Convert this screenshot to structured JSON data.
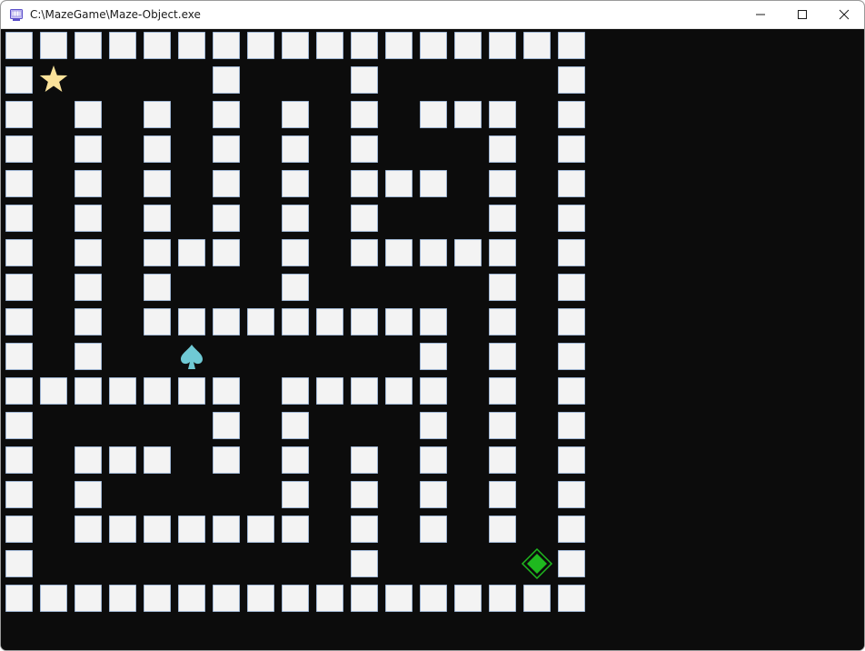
{
  "window": {
    "title": "C:\\MazeGame\\Maze-Object.exe",
    "app_icon": "application-icon",
    "controls": [
      "minimize-icon",
      "maximize-icon",
      "close-icon"
    ]
  },
  "maze": {
    "rows": 17,
    "cols": 17,
    "grid": [
      "#################",
      "#.....#...#.....#",
      "#.#.#.#.#.#.###.#",
      "#.#.#.#.#.#...#.#",
      "#.#.#.#.#.###.#.#",
      "#.#.#.#.#.#...#.#",
      "#.#.###.#.#####.#",
      "#.#.#...#.....#.#",
      "#.#.#########.#.#",
      "#.#.........#.#.#",
      "#######.#####.#.#",
      "#.....#.#...#.#.#",
      "#.###.#.#.#.#.#.#",
      "#.#.....#.#.#.#.#",
      "#.#######.#.#.#.#",
      "#.........#.....#",
      "#################"
    ],
    "colors": {
      "background": "#0c0c0c",
      "wall_fill": "#f3f3f3",
      "wall_edge": "#a8c4e8",
      "star": "#fbe29a",
      "spade": "#6fc9d4",
      "diamond": "#1fb81f",
      "diamond_outline": "#1fb81f"
    },
    "objects": [
      {
        "name": "star-icon",
        "glyph": "star",
        "row": 1,
        "col": 1
      },
      {
        "name": "spade-icon",
        "glyph": "spade",
        "row": 9,
        "col": 5
      },
      {
        "name": "diamond-icon",
        "glyph": "diamond",
        "row": 15,
        "col": 15
      }
    ]
  }
}
